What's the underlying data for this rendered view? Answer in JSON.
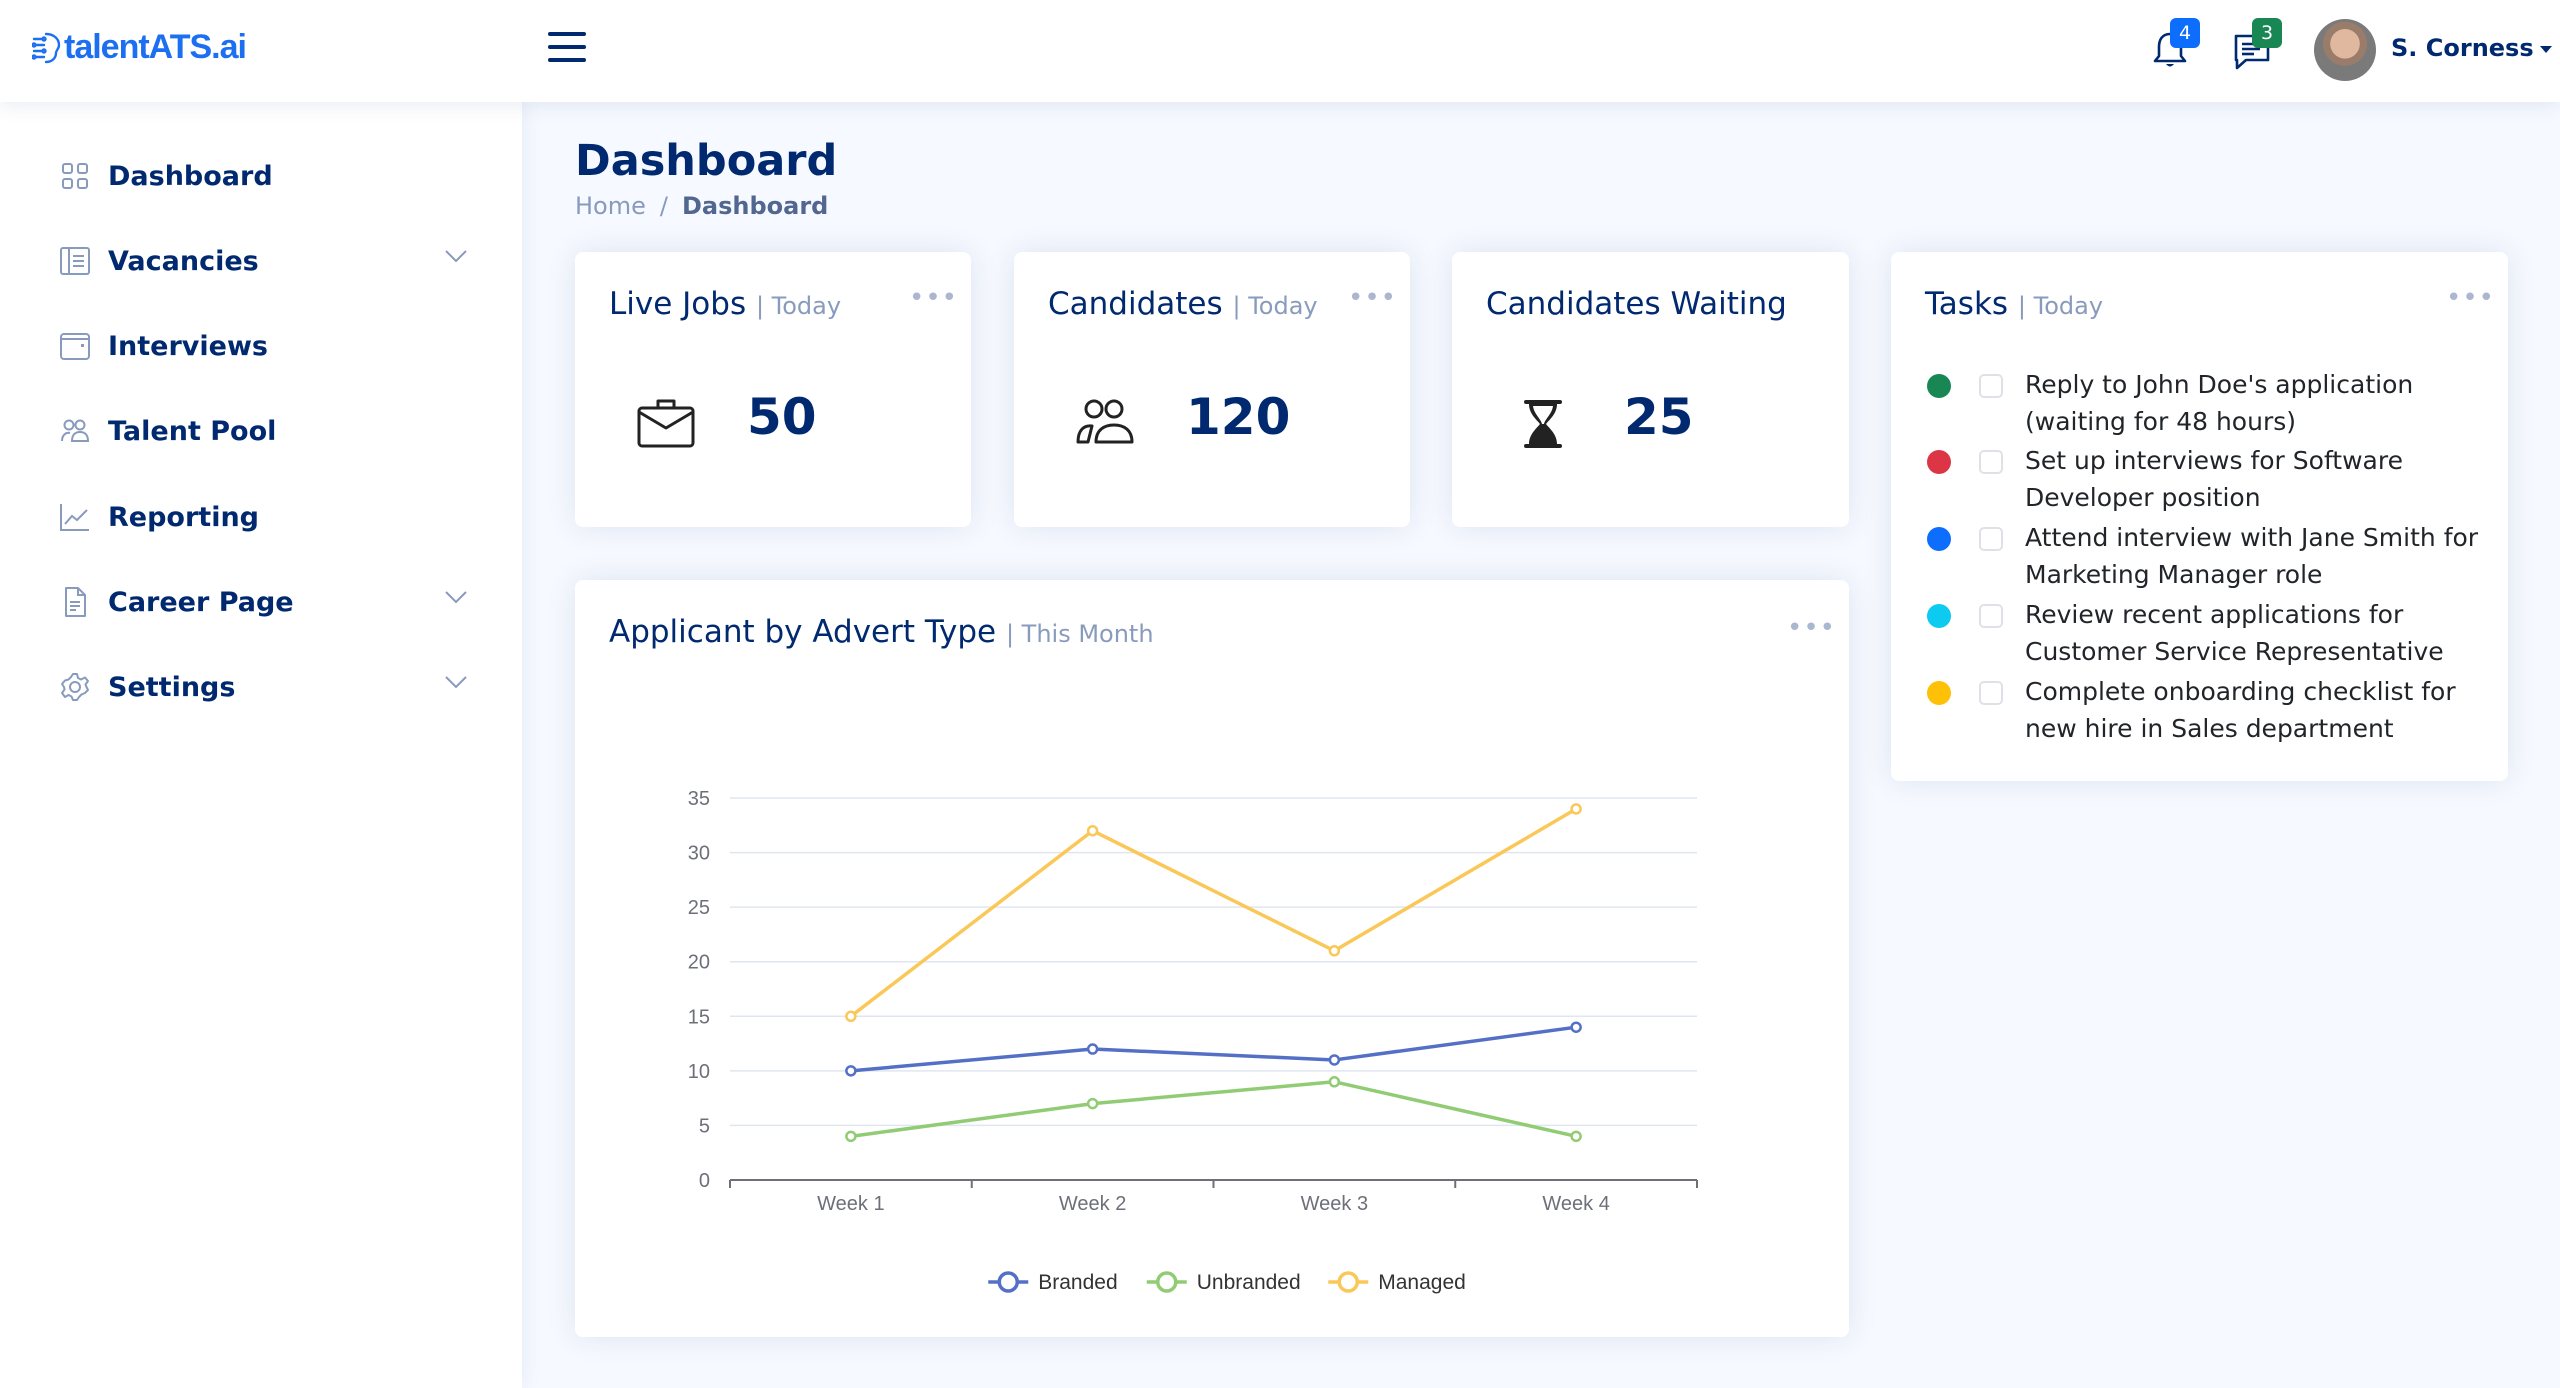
{
  "header": {
    "logo_text": "talentATS.ai",
    "notifications_count": "4",
    "messages_count": "3",
    "user_name": "S. Corness",
    "colors": {
      "notif_badge": "#0d6efd",
      "msg_badge": "#198754"
    }
  },
  "sidebar": {
    "items": [
      {
        "label": "Dashboard",
        "icon": "grid-icon",
        "expandable": false
      },
      {
        "label": "Vacancies",
        "icon": "layout-text-sidebar-icon",
        "expandable": true
      },
      {
        "label": "Interviews",
        "icon": "calendar-icon",
        "expandable": false
      },
      {
        "label": "Talent Pool",
        "icon": "people-icon",
        "expandable": false
      },
      {
        "label": "Reporting",
        "icon": "graph-up-icon",
        "expandable": false
      },
      {
        "label": "Career Page",
        "icon": "file-text-icon",
        "expandable": true
      },
      {
        "label": "Settings",
        "icon": "gear-icon",
        "expandable": true
      }
    ]
  },
  "page": {
    "title": "Dashboard",
    "breadcrumb": [
      "Home",
      "/",
      "Dashboard"
    ]
  },
  "cards": {
    "live_jobs": {
      "title": "Live Jobs",
      "period": "| Today",
      "value": "50",
      "icon": "briefcase-icon"
    },
    "candidates": {
      "title": "Candidates",
      "period": "| Today",
      "value": "120",
      "icon": "people-icon"
    },
    "waiting": {
      "title": "Candidates Waiting",
      "value": "25",
      "icon": "hourglass-icon"
    }
  },
  "tasks": {
    "title": "Tasks",
    "period": "| Today",
    "items": [
      {
        "text": "Reply to John Doe's application (waiting for 48 hours)",
        "color": "#198754",
        "checked": false
      },
      {
        "text": "Set up interviews for Software Developer position",
        "color": "#dc3545",
        "checked": false
      },
      {
        "text": "Attend interview with Jane Smith for Marketing Manager role",
        "color": "#0d6efd",
        "checked": false
      },
      {
        "text": "Review recent applications for Customer Service Representative",
        "color": "#0dcaf0",
        "checked": false
      },
      {
        "text": "Complete onboarding checklist for new hire in Sales department",
        "color": "#ffc107",
        "checked": false
      }
    ]
  },
  "chart_card": {
    "title": "Applicant by Advert Type",
    "period": "| This Month"
  },
  "chart_data": {
    "type": "line",
    "title": "Applicant by Advert Type",
    "categories": [
      "Week 1",
      "Week 2",
      "Week 3",
      "Week 4"
    ],
    "series": [
      {
        "name": "Branded",
        "values": [
          10,
          12,
          11,
          14
        ],
        "color": "#5470c6"
      },
      {
        "name": "Unbranded",
        "values": [
          4,
          7,
          9,
          4
        ],
        "color": "#91cc75"
      },
      {
        "name": "Managed",
        "values": [
          15,
          32,
          21,
          34
        ],
        "color": "#fac858"
      }
    ],
    "yticks": [
      0,
      5,
      10,
      15,
      20,
      25,
      30,
      35
    ],
    "ylim": [
      0,
      35
    ],
    "xlabel": "",
    "ylabel": "",
    "grid": true,
    "legend": "bottom-center"
  }
}
